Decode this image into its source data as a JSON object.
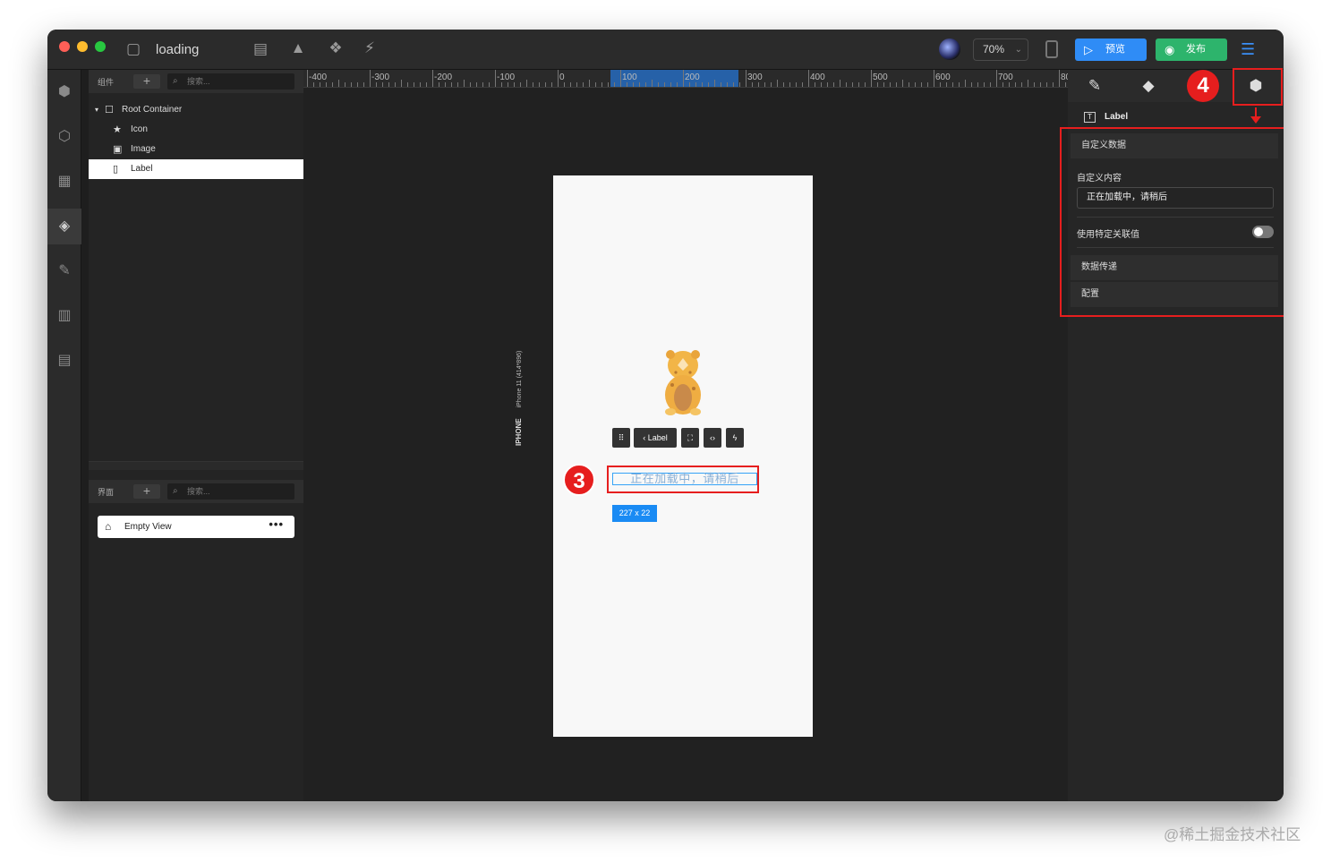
{
  "window": {
    "title": "loading"
  },
  "toolbar": {
    "zoom": "70%",
    "preview_label": "预览",
    "publish_label": "发布"
  },
  "left_panel": {
    "components": {
      "header_label": "组件",
      "search_placeholder": "搜索...",
      "tree": [
        {
          "label": "Root Container",
          "icon": "square-outline-icon"
        },
        {
          "label": "Icon",
          "icon": "star-icon"
        },
        {
          "label": "Image",
          "icon": "image-icon"
        },
        {
          "label": "Label",
          "icon": "text-box-icon",
          "selected": true
        }
      ]
    },
    "views": {
      "header_label": "界面",
      "search_placeholder": "搜索...",
      "items": [
        {
          "label": "Empty View",
          "icon": "home-icon",
          "more": "•••"
        }
      ]
    }
  },
  "canvas": {
    "ruler_labels": [
      "-400",
      "-300",
      "-200",
      "-100",
      "0",
      "100",
      "200",
      "300",
      "400",
      "500",
      "600",
      "700",
      "80"
    ],
    "device_name": "IPHONE",
    "device_spec": "iPhone 11 (414*896)",
    "element_toolbar": {
      "label": "Label"
    },
    "label_text": "正在加载中，请稍后",
    "size_tag": "227 x 22",
    "annotation_number": "3"
  },
  "right_panel": {
    "annotation_number": "4",
    "component_name": "Label",
    "section_custom_data": "自定义数据",
    "custom_content_label": "自定义内容",
    "custom_content_value": "正在加载中，请稍后",
    "use_binding_label": "使用特定关联值",
    "use_binding_on": false,
    "section_data_transfer": "数据传递",
    "section_config": "配置"
  },
  "watermark": "@稀土掘金技术社区",
  "colors": {
    "accent_blue": "#2f8cf6",
    "publish_green": "#2db46c",
    "annotation_red": "#e61e1e"
  }
}
